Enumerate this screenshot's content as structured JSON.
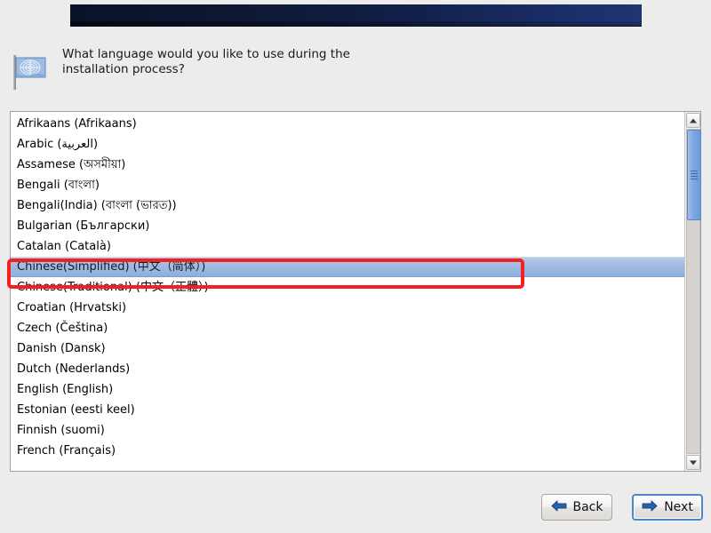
{
  "window": {
    "background_color": "#ececec",
    "banner_color_start": "#0a1228",
    "banner_color_end": "#203472"
  },
  "prompt": {
    "icon": "un-flag-icon",
    "text": "What language would you like to use during the\ninstallation process?"
  },
  "language_list": {
    "selected_index": 7,
    "selected_value": "Chinese(Simplified) (中文（简体）)",
    "items": [
      "Afrikaans (Afrikaans)",
      "Arabic (العربية)",
      "Assamese (অসমীয়া)",
      "Bengali (বাংলা)",
      "Bengali(India) (বাংলা (ভারত))",
      "Bulgarian (Български)",
      "Catalan (Català)",
      "Chinese(Simplified) (中文（简体）)",
      "Chinese(Traditional) (中文（正體）)",
      "Croatian (Hrvatski)",
      "Czech (Čeština)",
      "Danish (Dansk)",
      "Dutch (Nederlands)",
      "English (English)",
      "Estonian (eesti keel)",
      "Finnish (suomi)",
      "French (Français)"
    ]
  },
  "scrollbar": {
    "up_arrow": "chevron-up-icon",
    "down_arrow": "chevron-down-icon",
    "thumb_position_percent": 4,
    "thumb_size_percent": 28
  },
  "annotation": {
    "color": "#f41f1f",
    "target": "Chinese(Simplified) (中文（简体）)"
  },
  "footer": {
    "back_label": "Back",
    "back_icon": "arrow-left-icon",
    "next_label": "Next",
    "next_icon": "arrow-right-icon",
    "next_focus_color": "#4f86c8"
  }
}
